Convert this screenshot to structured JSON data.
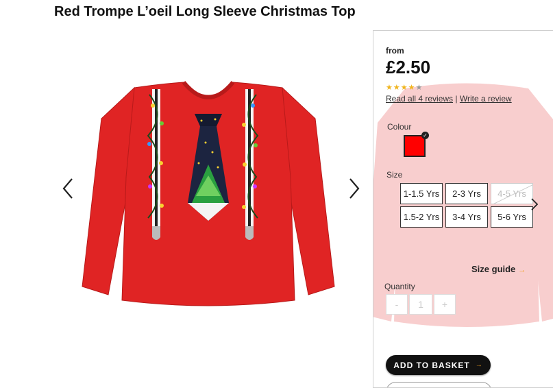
{
  "product": {
    "title": "Red Trompe L’oeil Long Sleeve Christmas Top",
    "price_prefix": "from",
    "price": "£2.50",
    "rating": {
      "value": 4,
      "max": 5
    },
    "reviews_link": "Read all 4 reviews",
    "reviews_separator": "|",
    "write_review_link": "Write a review"
  },
  "colour": {
    "label": "Colour",
    "selected_swatch": "#ff0000"
  },
  "size": {
    "label": "Size",
    "options": [
      {
        "label": "1-1.5 Yrs",
        "available": true
      },
      {
        "label": "2-3 Yrs",
        "available": true
      },
      {
        "label": "4-5 Yrs",
        "available": false
      },
      {
        "label": "1.5-2 Yrs",
        "available": true
      },
      {
        "label": "3-4 Yrs",
        "available": true
      },
      {
        "label": "5-6 Yrs",
        "available": true
      }
    ],
    "guide_label": "Size guide"
  },
  "quantity": {
    "label": "Quantity",
    "decrement": "-",
    "value": "1",
    "increment": "+"
  },
  "actions": {
    "add_to_basket": "ADD TO BASKET"
  },
  "icons": {
    "gallery_prev": "chevron-left-icon",
    "gallery_next": "chevron-right-icon",
    "size_next": "chevron-right-icon",
    "selected_check": "check-icon"
  },
  "colors": {
    "top_red": "#e02424",
    "accent_orange": "#f0a020",
    "star_gold": "#f0b41c"
  }
}
